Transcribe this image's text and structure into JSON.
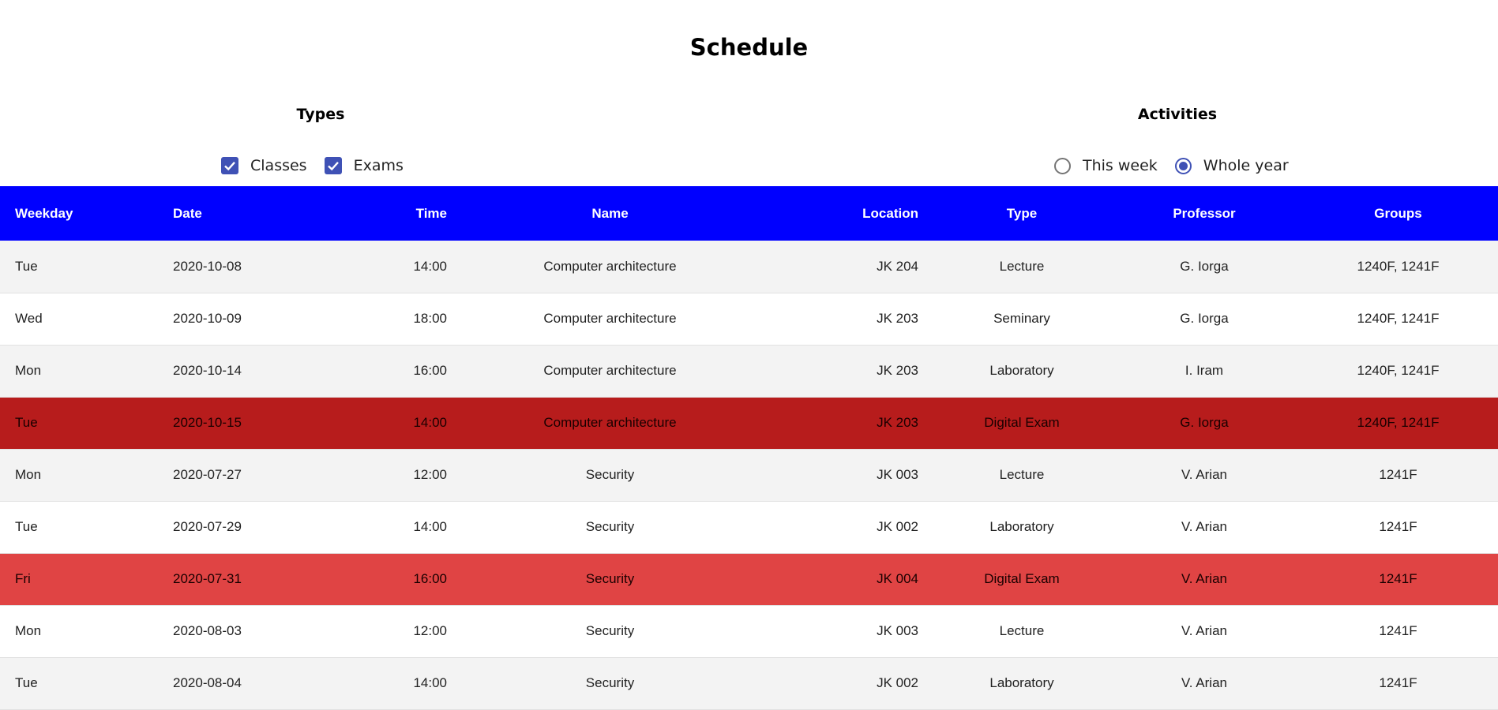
{
  "page": {
    "title": "Schedule"
  },
  "types": {
    "title": "Types",
    "options": [
      {
        "label": "Classes",
        "checked": true
      },
      {
        "label": "Exams",
        "checked": true
      }
    ]
  },
  "activities": {
    "title": "Activities",
    "options": [
      {
        "label": "This week",
        "selected": false
      },
      {
        "label": "Whole year",
        "selected": true
      }
    ]
  },
  "colors": {
    "header_bg": "#0000ff",
    "accent": "#3f51b5",
    "exam_dark": "#b71c1c",
    "exam_light": "#e04444",
    "row_alt": "#f3f3f3"
  },
  "table": {
    "columns": [
      "Weekday",
      "Date",
      "Time",
      "Name",
      "Location",
      "Type",
      "Professor",
      "Groups"
    ],
    "rows": [
      {
        "weekday": "Tue",
        "date": "2020-10-08",
        "time": "14:00",
        "name": "Computer architecture",
        "location": "JK 204",
        "type": "Lecture",
        "professor": "G. Iorga",
        "groups": "1240F, 1241F"
      },
      {
        "weekday": "Wed",
        "date": "2020-10-09",
        "time": "18:00",
        "name": "Computer architecture",
        "location": "JK 203",
        "type": "Seminary",
        "professor": "G. Iorga",
        "groups": "1240F, 1241F"
      },
      {
        "weekday": "Mon",
        "date": "2020-10-14",
        "time": "16:00",
        "name": "Computer architecture",
        "location": "JK 203",
        "type": "Laboratory",
        "professor": "I. Iram",
        "groups": "1240F, 1241F"
      },
      {
        "weekday": "Tue",
        "date": "2020-10-15",
        "time": "14:00",
        "name": "Computer architecture",
        "location": "JK 203",
        "type": "Digital Exam",
        "professor": "G. Iorga",
        "groups": "1240F, 1241F"
      },
      {
        "weekday": "Mon",
        "date": "2020-07-27",
        "time": "12:00",
        "name": "Security",
        "location": "JK 003",
        "type": "Lecture",
        "professor": "V. Arian",
        "groups": "1241F"
      },
      {
        "weekday": "Tue",
        "date": "2020-07-29",
        "time": "14:00",
        "name": "Security",
        "location": "JK 002",
        "type": "Laboratory",
        "professor": "V. Arian",
        "groups": "1241F"
      },
      {
        "weekday": "Fri",
        "date": "2020-07-31",
        "time": "16:00",
        "name": "Security",
        "location": "JK 004",
        "type": "Digital Exam",
        "professor": "V. Arian",
        "groups": "1241F"
      },
      {
        "weekday": "Mon",
        "date": "2020-08-03",
        "time": "12:00",
        "name": "Security",
        "location": "JK 003",
        "type": "Lecture",
        "professor": "V. Arian",
        "groups": "1241F"
      },
      {
        "weekday": "Tue",
        "date": "2020-08-04",
        "time": "14:00",
        "name": "Security",
        "location": "JK 002",
        "type": "Laboratory",
        "professor": "V. Arian",
        "groups": "1241F"
      }
    ]
  }
}
